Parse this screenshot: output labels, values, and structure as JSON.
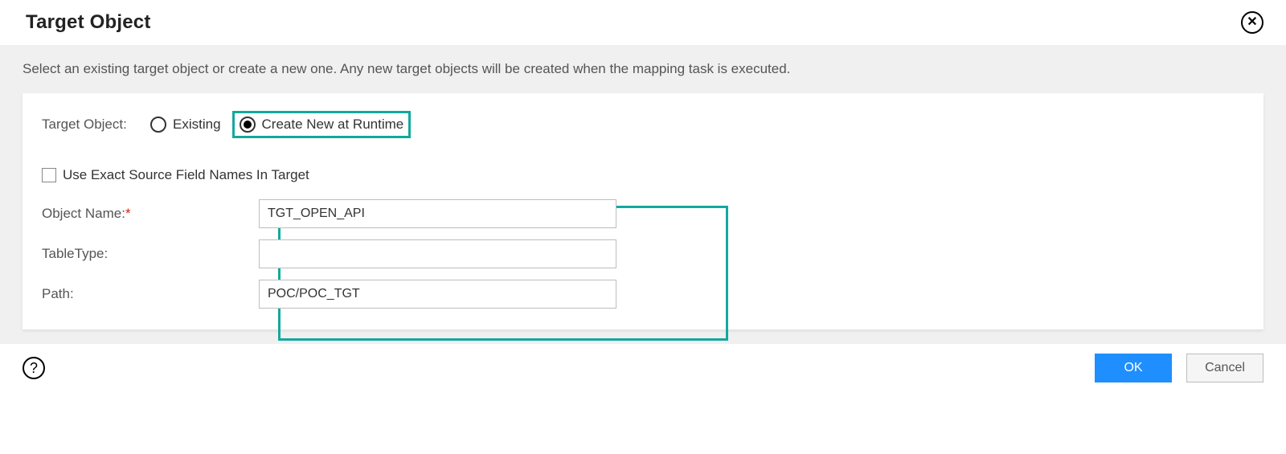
{
  "dialog": {
    "title": "Target Object",
    "instruction": "Select an existing target object or create a new one. Any new target objects will be created when the mapping task is executed."
  },
  "targetObjectRow": {
    "label": "Target Object:",
    "existing": "Existing",
    "createNew": "Create New at Runtime",
    "selected": "createNew"
  },
  "useExact": {
    "label": "Use Exact Source Field Names In Target",
    "checked": false
  },
  "fields": {
    "objectName": {
      "label": "Object Name:",
      "value": "TGT_OPEN_API",
      "required": true
    },
    "tableType": {
      "label": "TableType:",
      "value": ""
    },
    "path": {
      "label": "Path:",
      "value": "POC/POC_TGT"
    }
  },
  "footer": {
    "ok": "OK",
    "cancel": "Cancel"
  }
}
